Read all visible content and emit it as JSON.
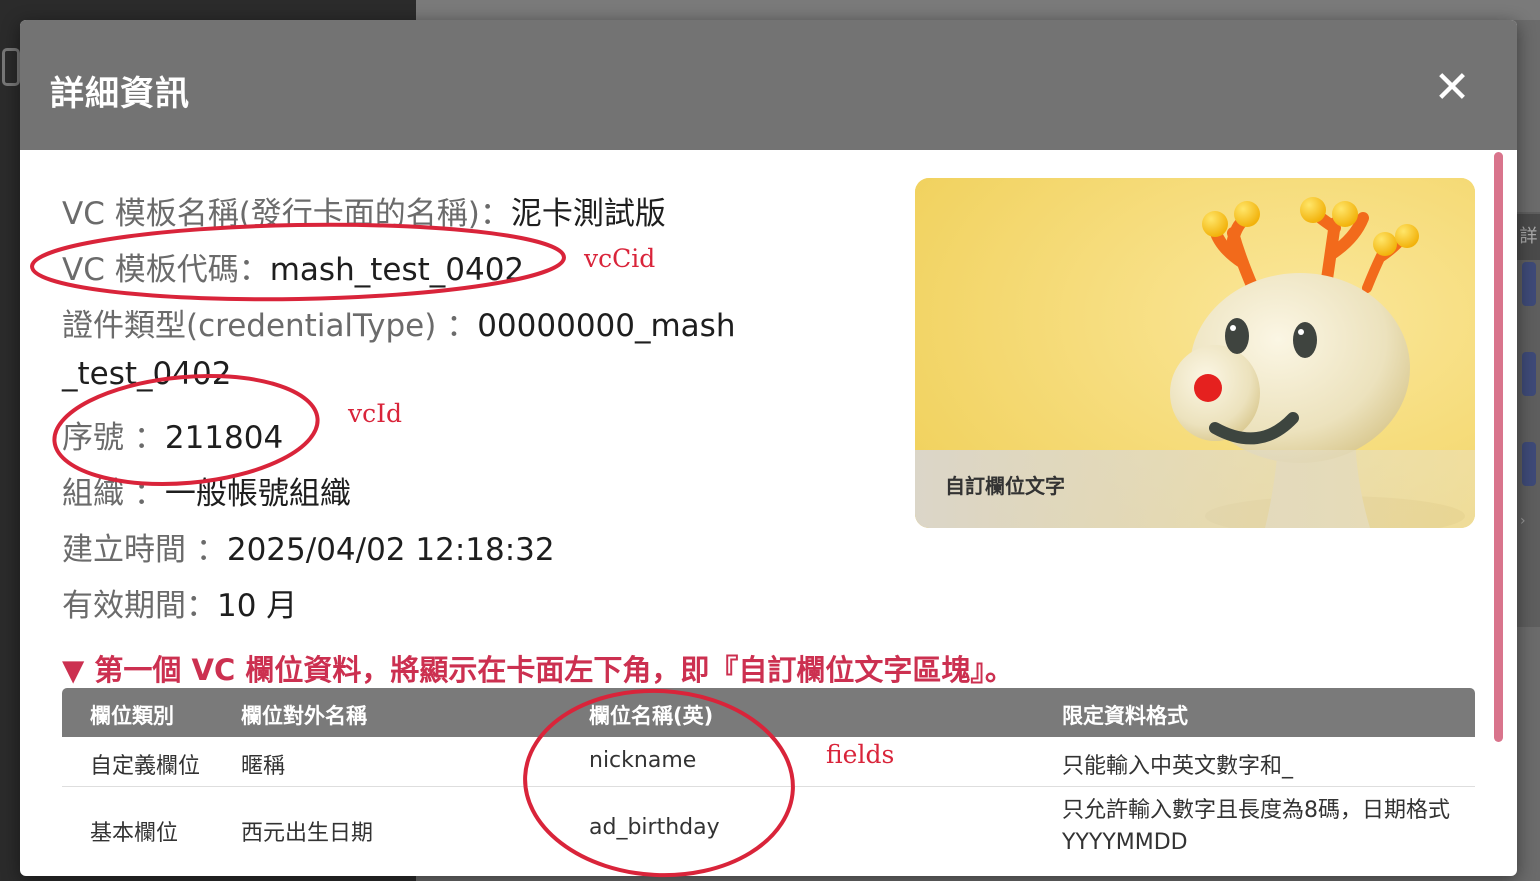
{
  "modal": {
    "title": "詳細資訊",
    "close_icon": "close-icon"
  },
  "info": {
    "template_name": {
      "label": "VC 模板名稱(發行卡面的名稱)：",
      "value": "泥卡測試版"
    },
    "template_code": {
      "label": "VC 模板代碼：",
      "value": "mash_test_0402"
    },
    "credential_type": {
      "label": "證件類型(credentialType) ：",
      "value": "00000000_mash",
      "value_cont": "_test_0402"
    },
    "serial": {
      "label": "序號 ：",
      "value": "211804"
    },
    "org": {
      "label": "組織 ：",
      "value": "一般帳號組織"
    },
    "created": {
      "label": "建立時間 ：",
      "value": "2025/04/02 12:18:32"
    },
    "validity": {
      "label": "有效期間：",
      "value": "10 月"
    }
  },
  "card": {
    "caption": "自訂欄位文字",
    "image": "yellow-toy-deer-illustration",
    "bg_color": "#f6de7c"
  },
  "section_note": "▼ 第一個 VC 欄位資料，將顯示在卡面左下角，即『自訂欄位文字區塊』。",
  "table": {
    "headers": [
      "欄位類別",
      "欄位對外名稱",
      "欄位名稱(英)",
      "限定資料格式"
    ],
    "rows": [
      [
        "自定義欄位",
        "暱稱",
        "nickname",
        "只能輸入中英文數字和_"
      ],
      [
        "基本欄位",
        "西元出生日期",
        "ad_birthday",
        "只允許輸入數字且長度為8碼，日期格式 YYYYMMDD"
      ]
    ]
  },
  "annotations": {
    "vcCid": "vcCid",
    "vcId": "vcId",
    "fields": "fields",
    "color": "#d9243a"
  },
  "colors": {
    "header_bg": "#737373",
    "accent_note": "#cc3050",
    "scroll_thumb": "#d9748c",
    "table_head": "#7a7a7a"
  },
  "background": {
    "right_tab_glyph": "詳",
    "right_arrow_glyph": "›"
  }
}
